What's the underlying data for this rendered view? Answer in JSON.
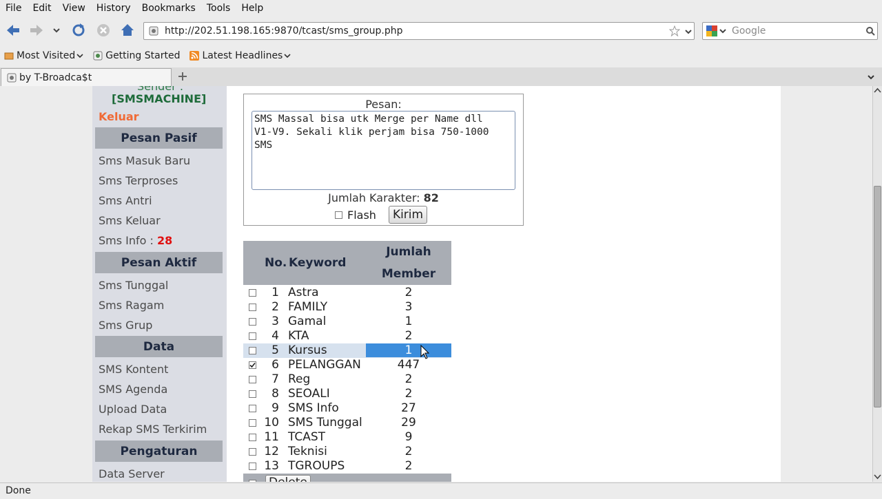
{
  "menu": [
    "File",
    "Edit",
    "View",
    "History",
    "Bookmarks",
    "Tools",
    "Help"
  ],
  "url": "http://202.51.198.165:9870/tcast/sms_group.php",
  "search_placeholder": "Google",
  "bookmarks": [
    "Most Visited",
    "Getting Started",
    "Latest Headlines"
  ],
  "tab_title": "by T-Broadca$t",
  "status": "Done",
  "sidebar": {
    "sender_label": "Sender :",
    "sender_value": "[SMSMACHINE]",
    "logout": "Keluar",
    "head_pasif": "Pesan Pasif",
    "pasif_items": [
      "Sms Masuk Baru",
      "Sms Terproses",
      "Sms Antri",
      "Sms Keluar"
    ],
    "info_label": "Sms Info :",
    "info_count": "28",
    "head_aktif": "Pesan Aktif",
    "aktif_items": [
      "Sms Tunggal",
      "Sms Ragam",
      "Sms Grup"
    ],
    "head_data": "Data",
    "data_items": [
      "SMS Kontent",
      "SMS Agenda",
      "Upload Data",
      "Rekap SMS Terkirim"
    ],
    "head_pengaturan": "Pengaturan",
    "pengaturan_items": [
      "Data Server"
    ]
  },
  "form": {
    "label": "Pesan:",
    "message": "SMS Massal bisa utk Merge per Name dll\nV1-V9. Sekali klik perjam bisa 750-1000\nSMS",
    "count_label": "Jumlah Karakter:",
    "count_value": "82",
    "flash_label": "Flash",
    "send_label": "Kirim"
  },
  "table": {
    "headers": [
      "No.",
      "Keyword",
      "Jumlah",
      "Member"
    ],
    "rows": [
      {
        "no": "1",
        "keyword": "Astra",
        "jumlah": "2",
        "checked": false
      },
      {
        "no": "2",
        "keyword": "FAMILY",
        "jumlah": "3",
        "checked": false
      },
      {
        "no": "3",
        "keyword": "Gamal",
        "jumlah": "1",
        "checked": false
      },
      {
        "no": "4",
        "keyword": "KTA",
        "jumlah": "2",
        "checked": false
      },
      {
        "no": "5",
        "keyword": "Kursus",
        "jumlah": "1",
        "checked": false
      },
      {
        "no": "6",
        "keyword": "PELANGGAN",
        "jumlah": "447",
        "checked": true
      },
      {
        "no": "7",
        "keyword": "Reg",
        "jumlah": "2",
        "checked": false
      },
      {
        "no": "8",
        "keyword": "SEOALI",
        "jumlah": "2",
        "checked": false
      },
      {
        "no": "9",
        "keyword": "SMS Info",
        "jumlah": "27",
        "checked": false
      },
      {
        "no": "10",
        "keyword": "SMS Tunggal",
        "jumlah": "29",
        "checked": false
      },
      {
        "no": "11",
        "keyword": "TCAST",
        "jumlah": "9",
        "checked": false
      },
      {
        "no": "12",
        "keyword": "Teknisi",
        "jumlah": "2",
        "checked": false
      },
      {
        "no": "13",
        "keyword": "TGROUPS",
        "jumlah": "2",
        "checked": false
      }
    ],
    "delete_label": "Delete"
  }
}
